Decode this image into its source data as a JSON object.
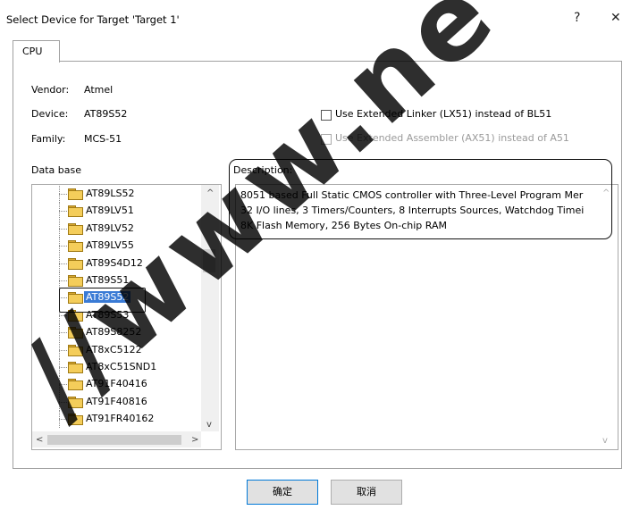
{
  "dialog": {
    "title": "Select Device for Target 'Target 1'",
    "help_label": "?",
    "close_label": "✕"
  },
  "tabs": [
    {
      "label": "CPU"
    }
  ],
  "info": {
    "vendor_label": "Vendor:",
    "vendor_value": "Atmel",
    "device_label": "Device:",
    "device_value": "AT89S52",
    "family_label": "Family:",
    "family_value": "MCS-51"
  },
  "options": {
    "linker_label": "Use Extended Linker (LX51) instead of BL51",
    "linker_checked": false,
    "assembler_label": "Use Extended Assembler (AX51) instead of A51",
    "assembler_checked": false,
    "assembler_enabled": false
  },
  "database": {
    "label": "Data base",
    "items": [
      "AT89LS52",
      "AT89LV51",
      "AT89LV52",
      "AT89LV55",
      "AT89S4D12",
      "AT89S51",
      "AT89S52",
      "AT89S53",
      "AT89S8252",
      "AT8xC5122",
      "AT8xC51SND1",
      "AT91F40416",
      "AT91F40816",
      "AT91FR40162"
    ],
    "selected": "AT89S52"
  },
  "description": {
    "label": "Description:",
    "lines": [
      "8051 based Full Static CMOS controller with Three-Level Program Mer",
      "32 I/O lines, 3 Timers/Counters, 8 Interrupts Sources, Watchdog Timei",
      "8K Flash Memory, 256 Bytes On-chip RAM"
    ]
  },
  "buttons": {
    "ok_label": "确定",
    "cancel_label": "取消"
  },
  "scroll": {
    "up_arrow": "^",
    "down_arrow": "v",
    "left_arrow": "<",
    "right_arrow": ">"
  }
}
